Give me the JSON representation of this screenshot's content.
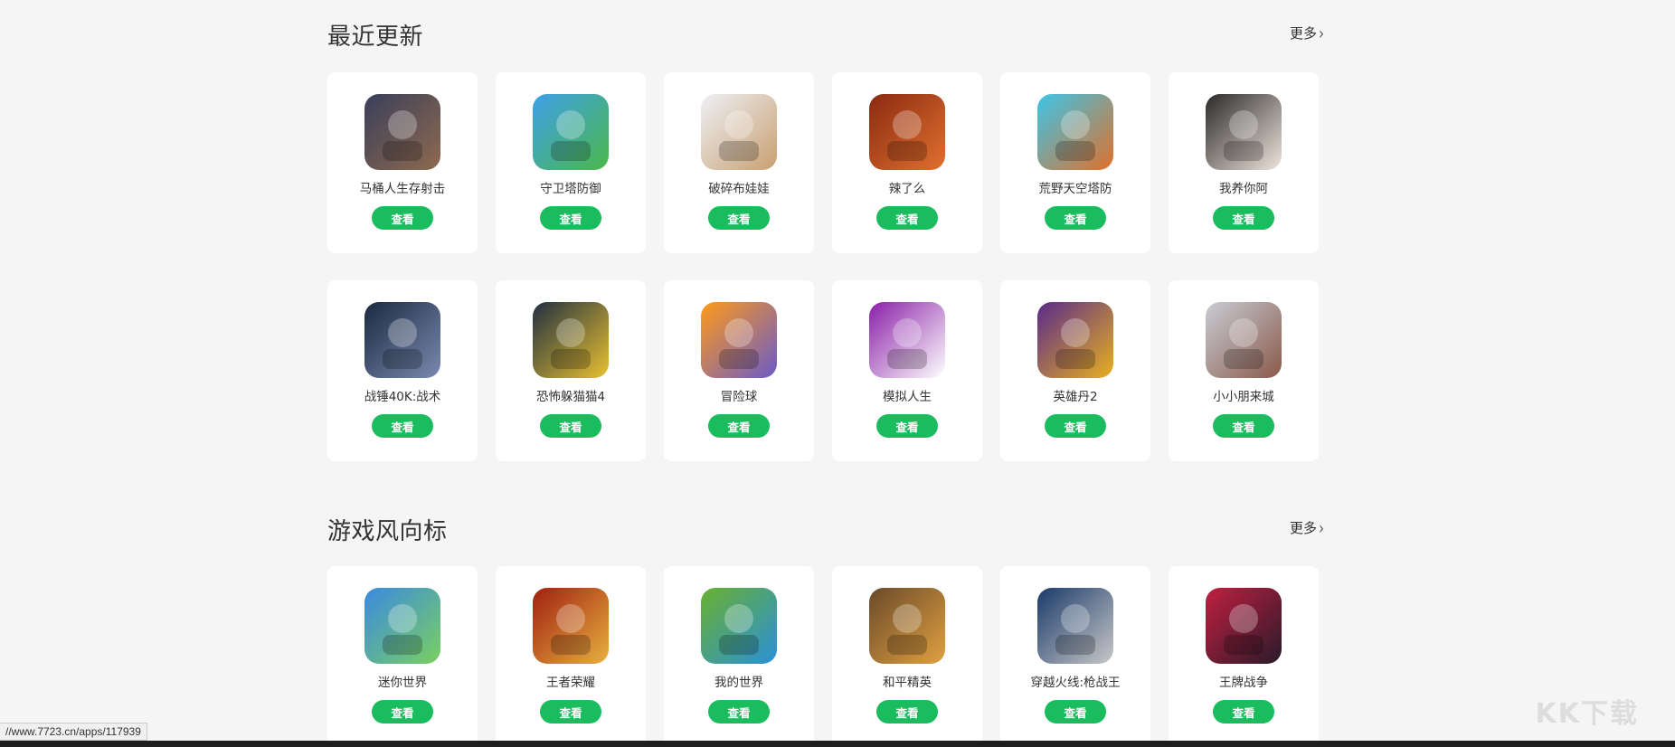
{
  "section1": {
    "title": "最近更新",
    "more": "更多",
    "apps": [
      {
        "name": "马桶人生存射击",
        "icon": "toilet-shooter-icon",
        "button": "查看",
        "colors": [
          "#3a3f5a",
          "#8e6a4f"
        ]
      },
      {
        "name": "守卫塔防御",
        "icon": "castle-icon",
        "button": "查看",
        "colors": [
          "#3fa0e8",
          "#4bb84a"
        ]
      },
      {
        "name": "破碎布娃娃",
        "icon": "ragdoll-icon",
        "button": "查看",
        "colors": [
          "#eef0f6",
          "#c8a070"
        ]
      },
      {
        "name": "辣了么",
        "icon": "hotpot-icon",
        "button": "查看",
        "colors": [
          "#8a2a10",
          "#e07030"
        ]
      },
      {
        "name": "荒野天空塔防",
        "icon": "sky-tower-icon",
        "button": "查看",
        "colors": [
          "#3bc6e8",
          "#e0702a"
        ]
      },
      {
        "name": "我养你阿",
        "icon": "cartoon-man-icon",
        "button": "查看",
        "colors": [
          "#2a2a2a",
          "#f0e4dc"
        ]
      }
    ]
  },
  "section1_row2": {
    "apps": [
      {
        "name": "战锤40K:战术",
        "icon": "warhammer-icon",
        "button": "查看",
        "colors": [
          "#1a2a40",
          "#7a8ab0"
        ]
      },
      {
        "name": "恐怖躲猫猫4",
        "icon": "horror-hide-icon",
        "button": "查看",
        "colors": [
          "#203040",
          "#e8c030"
        ]
      },
      {
        "name": "冒险球",
        "icon": "adventure-ball-icon",
        "button": "查看",
        "colors": [
          "#ff9a1a",
          "#6a5ac8"
        ]
      },
      {
        "name": "模拟人生",
        "icon": "bitlife-icon",
        "button": "查看",
        "colors": [
          "#8a1fa8",
          "#ffffff"
        ]
      },
      {
        "name": "英雄丹2",
        "icon": "dan-the-man-icon",
        "button": "查看",
        "colors": [
          "#5a2a8a",
          "#e8b020"
        ]
      },
      {
        "name": "小小朋来城",
        "icon": "mask-girl-icon",
        "button": "查看",
        "colors": [
          "#c8ccd4",
          "#8a5a4a"
        ]
      }
    ]
  },
  "section2": {
    "title": "游戏风向标",
    "more": "更多",
    "apps": [
      {
        "name": "迷你世界",
        "icon": "mini-world-icon",
        "button": "查看",
        "colors": [
          "#3a8ae0",
          "#7ad060"
        ]
      },
      {
        "name": "王者荣耀",
        "icon": "honor-of-kings-icon",
        "button": "查看",
        "colors": [
          "#a02010",
          "#e8b040"
        ]
      },
      {
        "name": "我的世界",
        "icon": "minecraft-icon",
        "button": "查看",
        "colors": [
          "#6ab030",
          "#2a90d8"
        ]
      },
      {
        "name": "和平精英",
        "icon": "peacekeeper-elite-icon",
        "button": "查看",
        "colors": [
          "#6a4a2a",
          "#e0a040"
        ]
      },
      {
        "name": "穿越火线:枪战王",
        "icon": "crossfire-icon",
        "button": "查看",
        "colors": [
          "#1a3a6a",
          "#c8c8c8"
        ]
      },
      {
        "name": "王牌战争",
        "icon": "ace-war-icon",
        "button": "查看",
        "colors": [
          "#c02040",
          "#2a1a2a"
        ]
      }
    ]
  },
  "status_url": "//www.7723.cn/apps/117939",
  "watermark": "KK下载",
  "accent_color": "#1bbc5e"
}
